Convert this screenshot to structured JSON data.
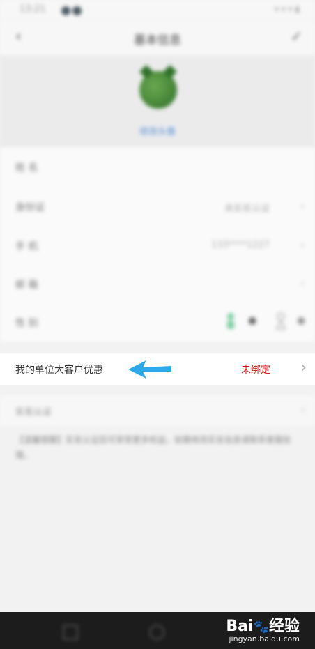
{
  "status_bar": {
    "time": "13:21"
  },
  "nav": {
    "title": "基本信息"
  },
  "profile": {
    "avatar_link": "修改头像"
  },
  "form_rows": [
    {
      "label": "姓 名",
      "value": ""
    },
    {
      "label": "身份证",
      "value": "未实名认证"
    },
    {
      "label": "手 机",
      "value": "133****1227"
    },
    {
      "label": "邮 箱",
      "value": ""
    },
    {
      "label": "性 别",
      "value": ""
    }
  ],
  "promo": {
    "label": "我的单位大客户优惠",
    "status": "未绑定"
  },
  "verify": {
    "label": "实名认证"
  },
  "notice": {
    "text": "【温馨提醒】实名认证后可享受更多权益，如需修改实名信息请联系客服处理。"
  },
  "watermark": {
    "brand": "Bai",
    "brand_cn": "经验",
    "url": "jingyan.baidu.com"
  },
  "colors": {
    "promo_status": "#e0201a",
    "arrow": "#2da8e8"
  }
}
